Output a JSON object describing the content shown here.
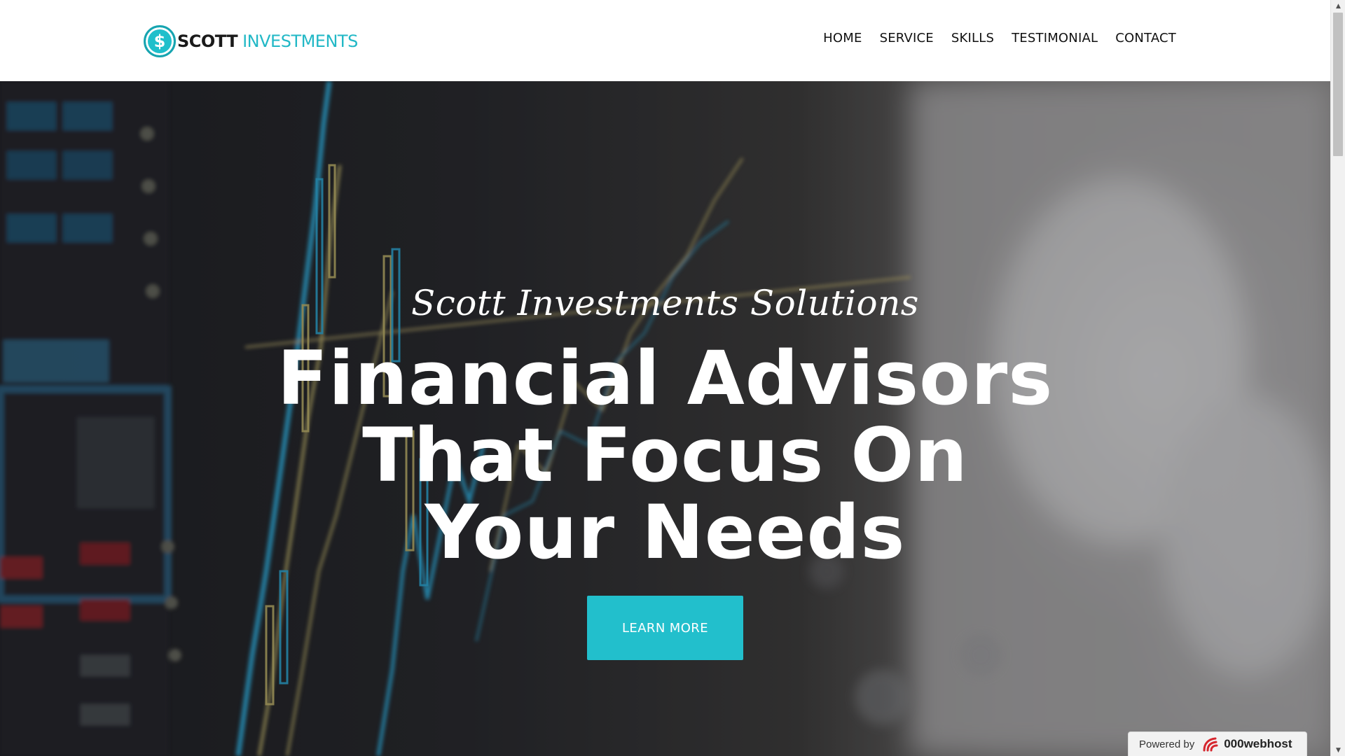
{
  "header": {
    "logo_icon_glyph": "$",
    "logo_word_1": "SCOTT",
    "logo_word_2": "INVESTMENTS",
    "brand_color": "#22b8c6"
  },
  "nav": {
    "items": [
      {
        "label": "HOME"
      },
      {
        "label": "SERVICE"
      },
      {
        "label": "SKILLS"
      },
      {
        "label": "TESTIMONIAL"
      },
      {
        "label": "CONTACT"
      }
    ]
  },
  "hero": {
    "script_heading": "Scott Investments Solutions",
    "title_lines": [
      "Financial Advisors",
      "That Focus On",
      "Your Needs"
    ],
    "button_label": "LEARN MORE",
    "button_color": "#22bfcc",
    "background_description_icon": "stock-chart-background"
  },
  "badge": {
    "powered_label": "Powered by",
    "brand": "000webhost",
    "brand_color": "#d6262e"
  },
  "scrollbar": {
    "up_glyph": "▲",
    "down_glyph": "▼"
  }
}
